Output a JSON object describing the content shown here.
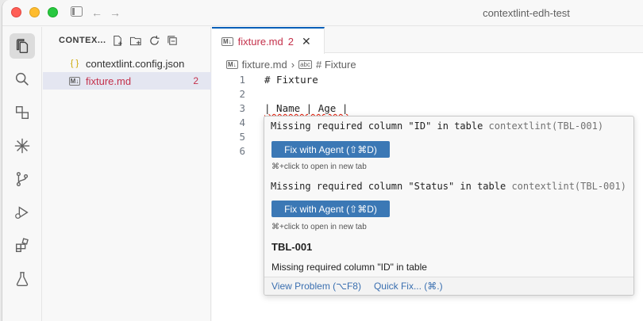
{
  "window": {
    "title": "contextlint-edh-test"
  },
  "sidebar": {
    "header": "CONTEX...",
    "files": [
      {
        "name": "contextlint.config.json",
        "icon": "{ }"
      },
      {
        "name": "fixture.md",
        "icon": "M↓",
        "badge": "2"
      }
    ]
  },
  "editor": {
    "tab": {
      "label": "fixture.md",
      "problems": "2",
      "close": "✕"
    },
    "breadcrumb": {
      "file": "fixture.md",
      "separator": "›",
      "symbol": "# Fixture"
    },
    "lines": [
      {
        "n": "1",
        "text": "# Fixture"
      },
      {
        "n": "2",
        "text": ""
      },
      {
        "n": "3",
        "text": "| Name | Age |"
      },
      {
        "n": "4",
        "text": ""
      },
      {
        "n": "5",
        "text": ""
      },
      {
        "n": "6",
        "text": ""
      }
    ]
  },
  "hover": {
    "problems": [
      {
        "message": "Missing required column \"ID\" in table",
        "source": "contextlint(TBL-001)",
        "button": "Fix with Agent (⇧⌘D)",
        "hint": "⌘+click to open in new tab"
      },
      {
        "message": "Missing required column \"Status\" in table",
        "source": "contextlint(TBL-001)",
        "button": "Fix with Agent (⇧⌘D)",
        "hint": "⌘+click to open in new tab"
      }
    ],
    "rule_title": "TBL-001",
    "rule_description": "Missing required column \"ID\" in table",
    "actions": {
      "view_problem": "View Problem (⌥F8)",
      "quick_fix": "Quick Fix... (⌘.)"
    }
  },
  "colors": {
    "accent": "#005fb8",
    "error": "#c4314b",
    "button": "#3b78b5"
  }
}
